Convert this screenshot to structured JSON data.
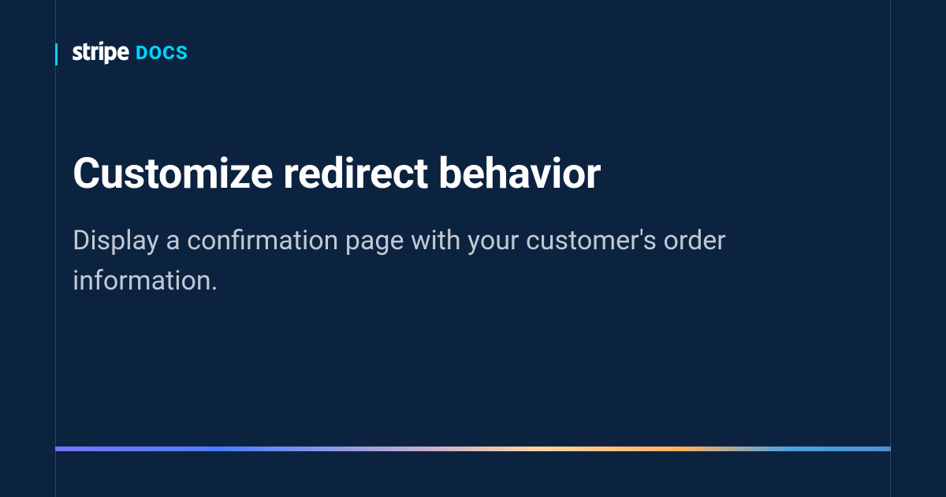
{
  "header": {
    "brand": "stripe",
    "product": "DOCS"
  },
  "main": {
    "title": "Customize redirect behavior",
    "subtitle": "Display a confirmation page with your customer's order information."
  }
}
